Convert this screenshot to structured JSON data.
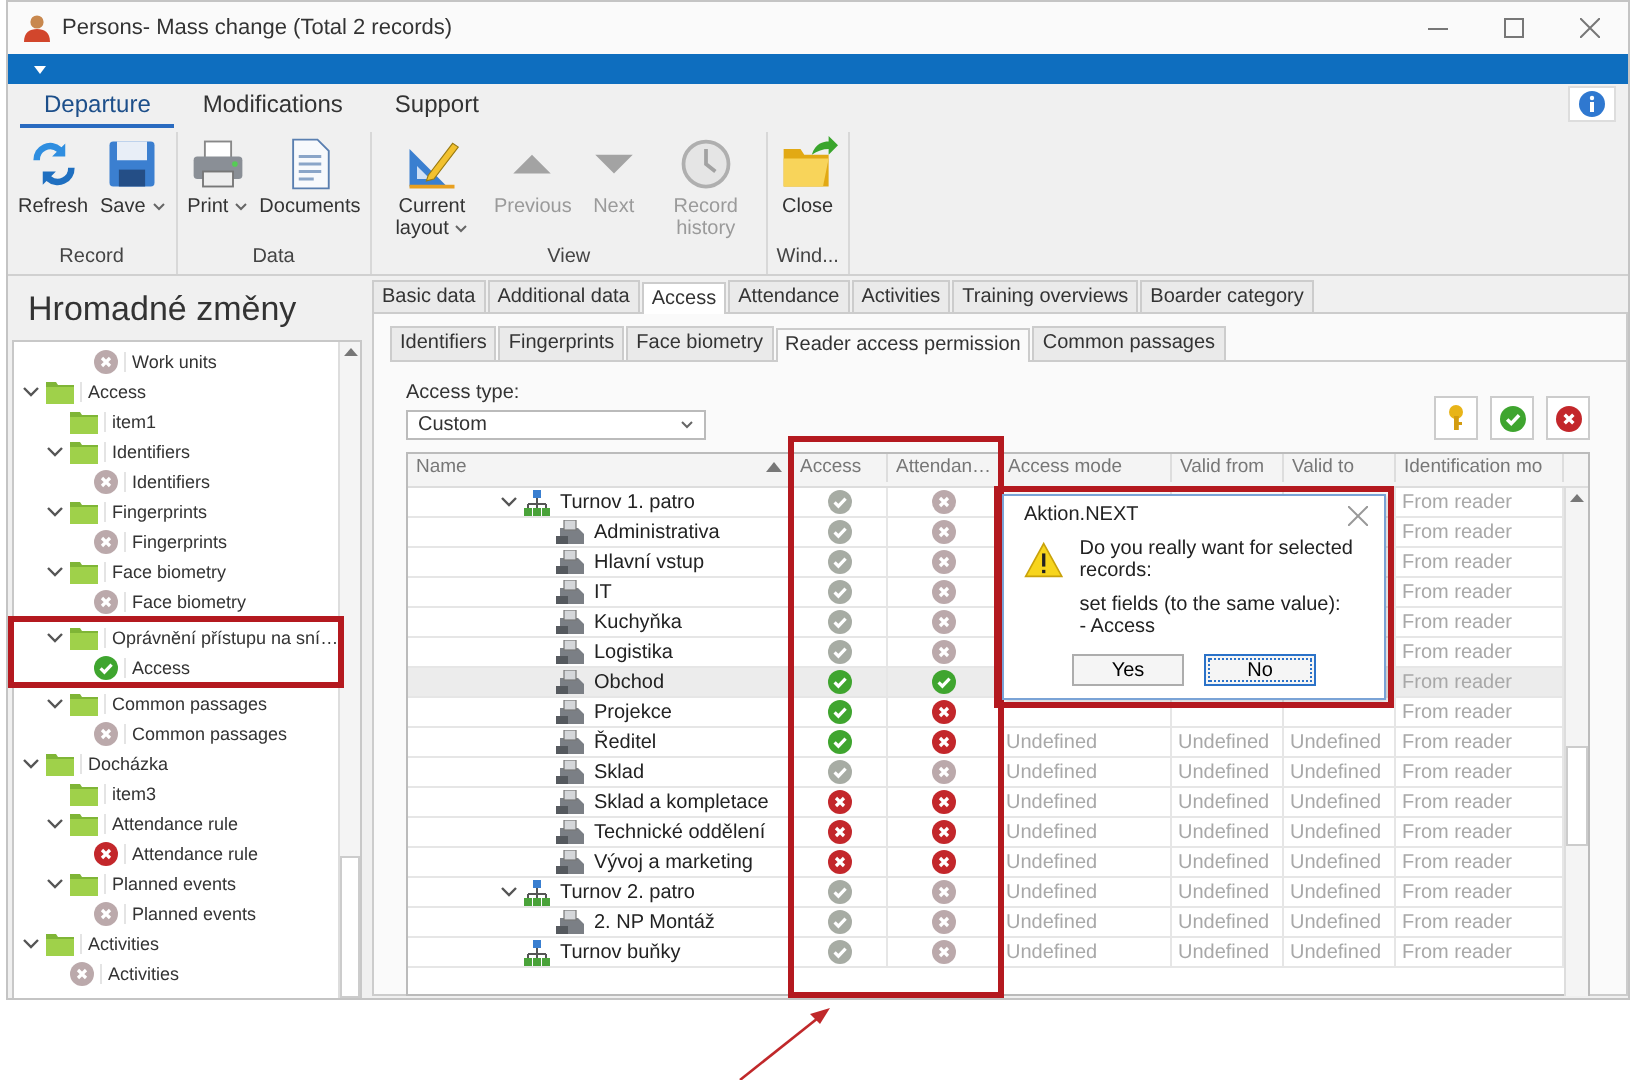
{
  "window": {
    "title": "Persons- Mass change (Total 2 records)"
  },
  "ribbon": {
    "tabs": [
      {
        "label": "Departure",
        "selected": true
      },
      {
        "label": "Modifications",
        "selected": false
      },
      {
        "label": "Support",
        "selected": false
      }
    ],
    "groups": [
      {
        "label": "Record",
        "buttons": [
          {
            "label": "Refresh",
            "kind": "refresh",
            "dropdown": false,
            "disabled": false
          },
          {
            "label": "Save",
            "kind": "save",
            "dropdown": true,
            "disabled": false
          }
        ]
      },
      {
        "label": "Data",
        "buttons": [
          {
            "label": "Print",
            "kind": "print",
            "dropdown": true,
            "disabled": false
          },
          {
            "label": "Documents",
            "kind": "documents",
            "dropdown": false,
            "disabled": false
          }
        ]
      },
      {
        "label": "View",
        "buttons": [
          {
            "label": "Current layout",
            "kind": "layout",
            "dropdown": true,
            "disabled": false
          },
          {
            "label": "Previous",
            "kind": "previous",
            "dropdown": false,
            "disabled": true
          },
          {
            "label": "Next",
            "kind": "next",
            "dropdown": false,
            "disabled": true
          },
          {
            "label": "Record history",
            "kind": "history",
            "dropdown": false,
            "disabled": true
          }
        ]
      },
      {
        "label": "Wind...",
        "buttons": [
          {
            "label": "Close",
            "kind": "close",
            "dropdown": false,
            "disabled": false
          }
        ]
      }
    ]
  },
  "sidebar": {
    "title": "Hromadné změny",
    "tree_continued": [
      {
        "label": "Work units",
        "kind": "unset"
      }
    ],
    "tree": [
      {
        "label": "Access",
        "kind": "folder",
        "expanded": true,
        "children": [
          {
            "label": "item1",
            "kind": "folder"
          },
          {
            "label": "Identifiers",
            "kind": "folder",
            "expanded": true,
            "children": [
              {
                "label": "Identifiers",
                "kind": "unset"
              }
            ]
          },
          {
            "label": "Fingerprints",
            "kind": "folder",
            "expanded": true,
            "children": [
              {
                "label": "Fingerprints",
                "kind": "unset"
              }
            ]
          },
          {
            "label": "Face biometry",
            "kind": "folder",
            "expanded": true,
            "children": [
              {
                "label": "Face biometry",
                "kind": "unset"
              }
            ]
          },
          {
            "label": "Oprávnění přístupu na sní…",
            "kind": "folder",
            "expanded": true,
            "annotated": true,
            "children": [
              {
                "label": "Access",
                "kind": "checked"
              }
            ]
          },
          {
            "label": "Common passages",
            "kind": "folder",
            "expanded": true,
            "children": [
              {
                "label": "Common passages",
                "kind": "unset"
              }
            ]
          }
        ]
      },
      {
        "label": "Docházka",
        "kind": "folder",
        "expanded": true,
        "children": [
          {
            "label": "item3",
            "kind": "folder"
          },
          {
            "label": "Attendance rule",
            "kind": "folder",
            "expanded": true,
            "children": [
              {
                "label": "Attendance rule",
                "kind": "denied"
              }
            ]
          },
          {
            "label": "Planned events",
            "kind": "folder",
            "expanded": true,
            "children": [
              {
                "label": "Planned events",
                "kind": "unset"
              }
            ]
          }
        ]
      },
      {
        "label": "Activities",
        "kind": "folder",
        "expanded": true,
        "children": [
          {
            "label": "Activities",
            "kind": "unset"
          }
        ]
      }
    ]
  },
  "detail": {
    "tabs": [
      {
        "label": "Basic data",
        "selected": false
      },
      {
        "label": "Additional data",
        "selected": false
      },
      {
        "label": "Access",
        "selected": true
      },
      {
        "label": "Attendance",
        "selected": false
      },
      {
        "label": "Activities",
        "selected": false
      },
      {
        "label": "Training overviews",
        "selected": false
      },
      {
        "label": "Boarder category",
        "selected": false
      }
    ],
    "subtabs": [
      {
        "label": "Identifiers",
        "selected": false
      },
      {
        "label": "Fingerprints",
        "selected": false
      },
      {
        "label": "Face biometry",
        "selected": false
      },
      {
        "label": "Reader access permission",
        "selected": true
      },
      {
        "label": "Common passages",
        "selected": false
      }
    ],
    "access_type": {
      "label": "Access type:",
      "value": "Custom"
    },
    "tools": [
      {
        "kind": "key"
      },
      {
        "kind": "confirm"
      },
      {
        "kind": "cancel"
      }
    ],
    "grid": {
      "columns": [
        {
          "label": "Name",
          "sorted": true,
          "annotated": false
        },
        {
          "label": "Access",
          "sorted": false,
          "annotated": true
        },
        {
          "label": "Attendan…",
          "sorted": false,
          "annotated": true
        },
        {
          "label": "Access mode",
          "sorted": false,
          "annotated": false
        },
        {
          "label": "Valid from",
          "sorted": false,
          "annotated": false
        },
        {
          "label": "Valid to",
          "sorted": false,
          "annotated": false
        },
        {
          "label": "Identification mo",
          "sorted": false,
          "annotated": false
        }
      ],
      "rows": [
        {
          "name": "Turnov 1. patro",
          "kind": "group",
          "expanded": true,
          "selected": false,
          "access": true,
          "access_inherited": true,
          "attendance": false,
          "attendance_inherited": true,
          "identification_mode": "From reader",
          "children": [
            {
              "name": "Administrativa",
              "kind": "reader",
              "selected": false,
              "access": true,
              "access_inherited": true,
              "attendance": false,
              "attendance_inherited": true,
              "identification_mode": "From reader"
            },
            {
              "name": "Hlavní vstup",
              "kind": "reader",
              "selected": false,
              "access": true,
              "access_inherited": true,
              "attendance": false,
              "attendance_inherited": true,
              "identification_mode": "From reader"
            },
            {
              "name": "IT",
              "kind": "reader",
              "selected": false,
              "access": true,
              "access_inherited": true,
              "attendance": false,
              "attendance_inherited": true,
              "identification_mode": "From reader"
            },
            {
              "name": "Kuchyňka",
              "kind": "reader",
              "selected": false,
              "access": true,
              "access_inherited": true,
              "attendance": false,
              "attendance_inherited": true,
              "identification_mode": "From reader"
            },
            {
              "name": "Logistika",
              "kind": "reader",
              "selected": false,
              "access": true,
              "access_inherited": true,
              "attendance": false,
              "attendance_inherited": true,
              "identification_mode": "From reader"
            },
            {
              "name": "Obchod",
              "kind": "reader",
              "selected": true,
              "access": true,
              "access_inherited": false,
              "attendance": true,
              "attendance_inherited": false,
              "identification_mode": "From reader"
            },
            {
              "name": "Projekce",
              "kind": "reader",
              "selected": false,
              "access": true,
              "access_inherited": false,
              "attendance": false,
              "attendance_inherited": false,
              "identification_mode": "From reader"
            },
            {
              "name": "Ředitel",
              "kind": "reader",
              "selected": false,
              "access": true,
              "access_inherited": false,
              "attendance": false,
              "attendance_inherited": false,
              "access_mode": "Undefined",
              "valid_from": "Undefined",
              "valid_to": "Undefined",
              "identification_mode": "From reader"
            },
            {
              "name": "Sklad",
              "kind": "reader",
              "selected": false,
              "access": true,
              "access_inherited": true,
              "attendance": false,
              "attendance_inherited": true,
              "access_mode": "Undefined",
              "valid_from": "Undefined",
              "valid_to": "Undefined",
              "identification_mode": "From reader"
            },
            {
              "name": "Sklad a kompletace",
              "kind": "reader",
              "selected": false,
              "access": false,
              "access_inherited": false,
              "attendance": false,
              "attendance_inherited": false,
              "access_mode": "Undefined",
              "valid_from": "Undefined",
              "valid_to": "Undefined",
              "identification_mode": "From reader"
            },
            {
              "name": "Technické oddělení",
              "kind": "reader",
              "selected": false,
              "access": false,
              "access_inherited": false,
              "attendance": false,
              "attendance_inherited": false,
              "access_mode": "Undefined",
              "valid_from": "Undefined",
              "valid_to": "Undefined",
              "identification_mode": "From reader"
            },
            {
              "name": "Vývoj a marketing",
              "kind": "reader",
              "selected": false,
              "access": false,
              "access_inherited": false,
              "attendance": false,
              "attendance_inherited": false,
              "access_mode": "Undefined",
              "valid_from": "Undefined",
              "valid_to": "Undefined",
              "identification_mode": "From reader"
            }
          ]
        },
        {
          "name": "Turnov 2. patro",
          "kind": "group",
          "expanded": true,
          "selected": false,
          "access": true,
          "access_inherited": true,
          "attendance": false,
          "attendance_inherited": true,
          "access_mode": "Undefined",
          "valid_from": "Undefined",
          "valid_to": "Undefined",
          "identification_mode": "From reader",
          "children": [
            {
              "name": "2. NP Montáž",
              "kind": "reader",
              "selected": false,
              "access": true,
              "access_inherited": true,
              "attendance": false,
              "attendance_inherited": true,
              "access_mode": "Undefined",
              "valid_from": "Undefined",
              "valid_to": "Undefined",
              "identification_mode": "From reader"
            }
          ]
        },
        {
          "name": "Turnov buňky",
          "kind": "group",
          "selected": false,
          "access": true,
          "access_inherited": true,
          "attendance": false,
          "attendance_inherited": true,
          "access_mode": "Undefined",
          "valid_from": "Undefined",
          "valid_to": "Undefined",
          "identification_mode": "From reader"
        }
      ]
    }
  },
  "dialog": {
    "title": "Aktion.NEXT",
    "annotated": true,
    "message": [
      "Do you really want for selected records:",
      "set fields (to the same value):",
      "- Access"
    ],
    "buttons": [
      {
        "label": "Yes",
        "default": false
      },
      {
        "label": "No",
        "default": true
      }
    ]
  }
}
